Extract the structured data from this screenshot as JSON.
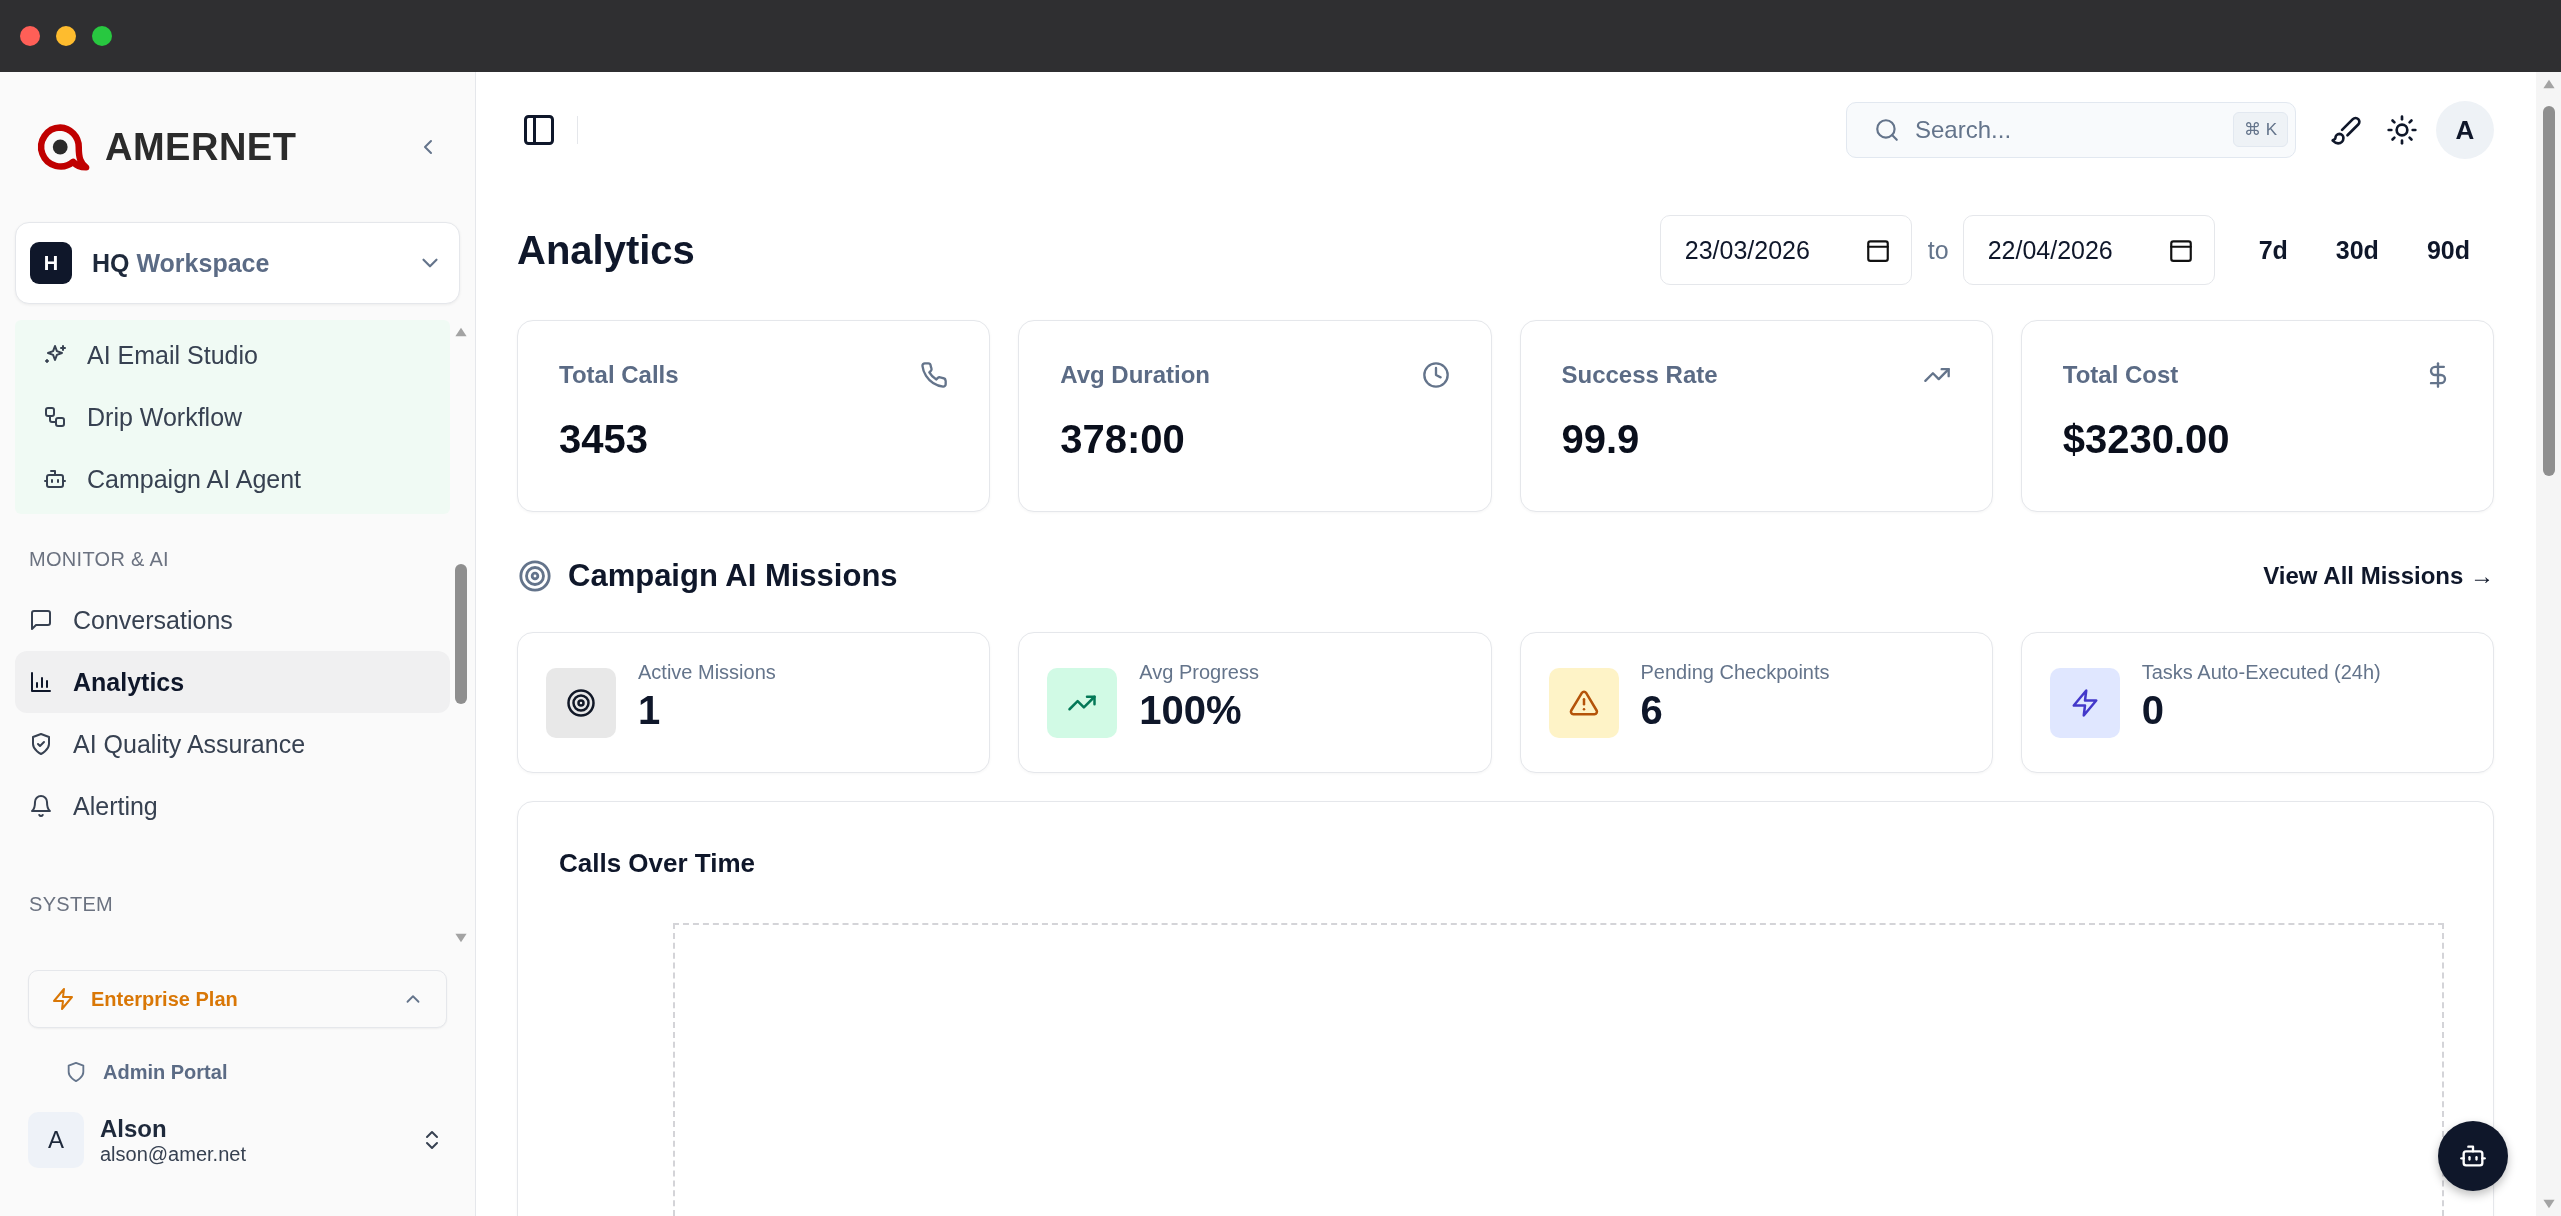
{
  "brand": {
    "name": "AMERNET"
  },
  "workspace": {
    "initial": "H",
    "name": "HQ",
    "label": "Workspace"
  },
  "campaign_items": [
    {
      "label": "AI Email Studio",
      "selected": false
    },
    {
      "label": "Drip Workflow",
      "selected": false
    },
    {
      "label": "Campaign AI Agent",
      "selected": false
    }
  ],
  "sections": [
    {
      "title": "MONITOR & AI",
      "items": [
        {
          "label": "Conversations",
          "selected": false
        },
        {
          "label": "Analytics",
          "selected": true
        },
        {
          "label": "AI Quality Assurance",
          "selected": false
        },
        {
          "label": "Alerting",
          "selected": false
        }
      ]
    },
    {
      "title": "SYSTEM"
    }
  ],
  "plan": {
    "label": "Enterprise Plan",
    "expanded": true,
    "items": [
      {
        "label": "Admin Portal"
      }
    ]
  },
  "user": {
    "initial": "A",
    "name": "Alson",
    "email": "alson@amer.net"
  },
  "topbar": {
    "search": {
      "placeholder": "Search...",
      "shortcut": "⌘ K"
    },
    "avatar": "A"
  },
  "page": {
    "title": "Analytics",
    "date_from": "23/03/2026",
    "to": "to",
    "date_to": "22/04/2026",
    "ranges": [
      "7d",
      "30d",
      "90d"
    ]
  },
  "stats": [
    {
      "label": "Total Calls",
      "value": "3453"
    },
    {
      "label": "Avg Duration",
      "value": "378:00"
    },
    {
      "label": "Success Rate",
      "value": "99.9"
    },
    {
      "label": "Total Cost",
      "value": "$3230.00"
    }
  ],
  "missions": {
    "title": "Campaign AI Missions",
    "link": "View All Missions →",
    "cards": [
      {
        "label": "Active Missions",
        "value": "1"
      },
      {
        "label": "Avg Progress",
        "value": "100%"
      },
      {
        "label": "Pending Checkpoints",
        "value": "6"
      },
      {
        "label": "Tasks Auto-Executed (24h)",
        "value": "0"
      }
    ]
  },
  "chart_card": {
    "title": "Calls Over Time"
  }
}
